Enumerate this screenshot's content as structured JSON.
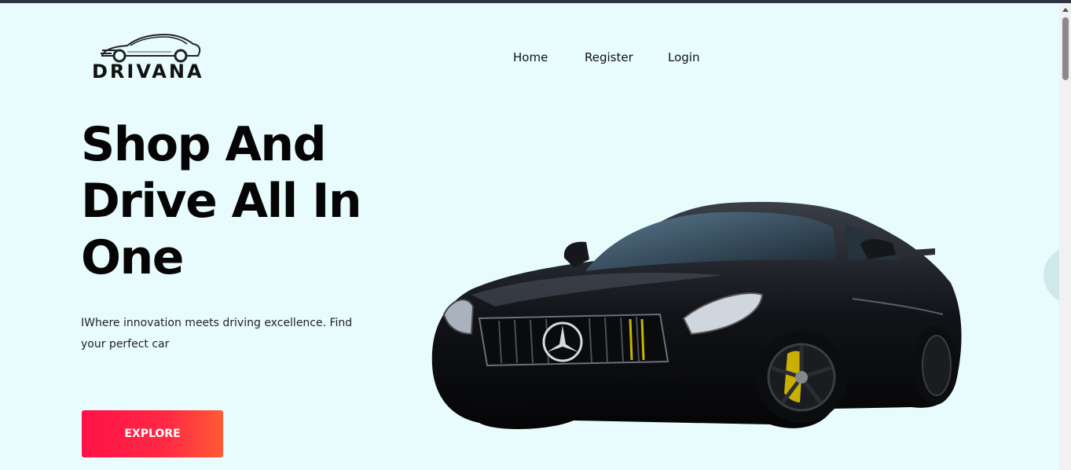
{
  "brand": {
    "name": "DRIVANA",
    "logo_icon": "car-silhouette-icon"
  },
  "nav": {
    "items": [
      {
        "label": "Home"
      },
      {
        "label": "Register"
      },
      {
        "label": "Login"
      }
    ]
  },
  "hero": {
    "title_lines": [
      "Shop And",
      "Drive All In",
      "One"
    ],
    "subtitle": "IWhere innovation meets driving excellence. Find your perfect car",
    "cta_label": "EXPLORE",
    "image": "sports-car-image"
  },
  "colors": {
    "background": "#e8fbfd",
    "cta_gradient_start": "#ff1248",
    "cta_gradient_end": "#ff5a34",
    "text": "#050505"
  }
}
